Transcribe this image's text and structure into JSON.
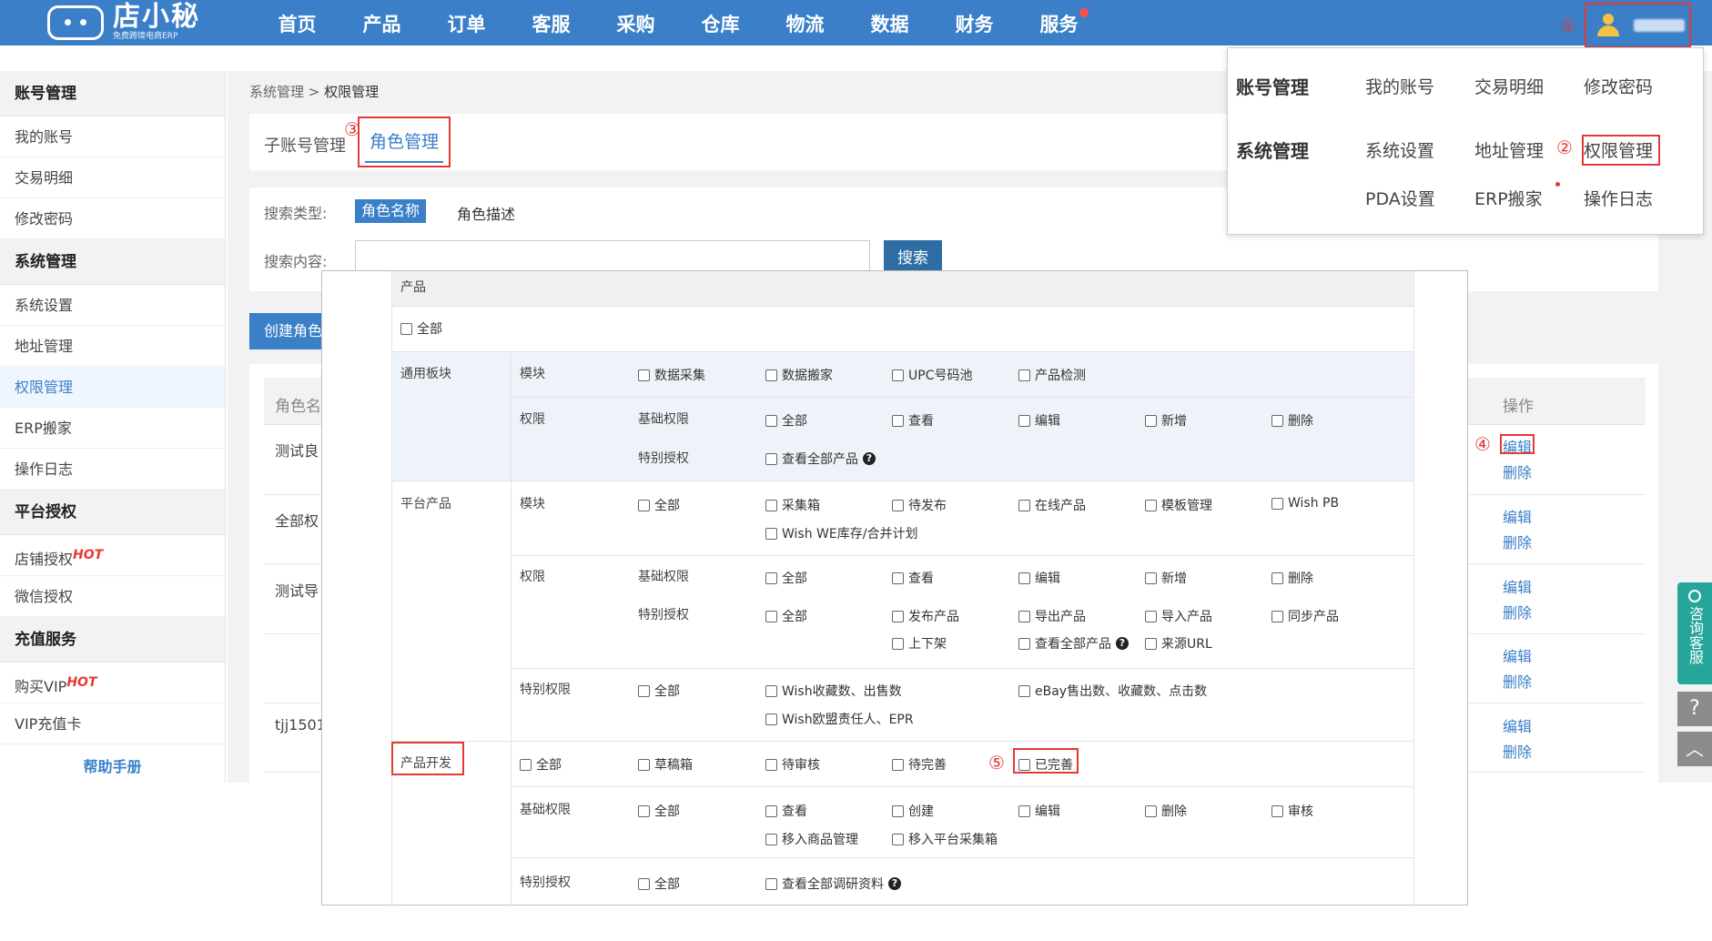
{
  "brand": {
    "name": "店小秘",
    "tagline": "免费跨境电商ERP"
  },
  "nav": {
    "items": [
      "首页",
      "产品",
      "订单",
      "客服",
      "采购",
      "仓库",
      "物流",
      "数据",
      "财务",
      "服务"
    ]
  },
  "markers": {
    "m1": "①",
    "m2": "②",
    "m3": "③",
    "m4": "④",
    "m5": "⑤"
  },
  "sidebar": {
    "groups": [
      {
        "title": "账号管理",
        "items": [
          "我的账号",
          "交易明细",
          "修改密码"
        ]
      },
      {
        "title": "系统管理",
        "items": [
          "系统设置",
          "地址管理",
          "权限管理",
          "ERP搬家",
          "操作日志"
        ]
      },
      {
        "title": "平台授权",
        "items": [
          "店铺授权",
          "微信授权"
        ]
      },
      {
        "title": "充值服务",
        "items": [
          "购买VIP",
          "VIP充值卡"
        ]
      }
    ],
    "hot": "HOT",
    "help": "帮助手册"
  },
  "breadcrumb": {
    "parent": "系统管理",
    "sep": ">",
    "current": "权限管理"
  },
  "tabs": {
    "sub_account": "子账号管理",
    "role": "角色管理"
  },
  "search": {
    "type_label": "搜索类型:",
    "type_active": "角色名称",
    "type_other": "角色描述",
    "content_label": "搜索内容:",
    "button": "搜索"
  },
  "create_button": "创建角色",
  "list": {
    "col_name": "角色名",
    "col_op": "操作",
    "rows": [
      "测试良",
      "全部权",
      "测试导",
      "",
      "tjj1501"
    ],
    "edit": "编辑",
    "delete": "删除"
  },
  "dropdown": {
    "account_head": "账号管理",
    "account_items": [
      "我的账号",
      "交易明细",
      "修改密码"
    ],
    "system_head": "系统管理",
    "system_items": [
      "系统设置",
      "地址管理",
      "权限管理"
    ],
    "system_items2": [
      "PDA设置",
      "ERP搬家",
      "操作日志"
    ]
  },
  "float": {
    "consult": "咨询客服",
    "help": "?",
    "top": "︿"
  },
  "modal": {
    "section": "产品",
    "all": "全部",
    "general": {
      "title": "通用板块",
      "module_label": "模块",
      "modules": [
        "数据采集",
        "数据搬家",
        "UPC号码池",
        "产品检测"
      ],
      "perm_label": "权限",
      "basic_label": "基础权限",
      "basic": [
        "全部",
        "查看",
        "编辑",
        "新增",
        "删除"
      ],
      "special_label": "特别授权",
      "special": [
        "查看全部产品"
      ]
    },
    "platform": {
      "title": "平台产品",
      "module_label": "模块",
      "modules": [
        "全部",
        "采集箱",
        "待发布",
        "在线产品",
        "模板管理",
        "Wish PB",
        "Wish WE库存/合并计划"
      ],
      "perm_label": "权限",
      "basic_label": "基础权限",
      "basic": [
        "全部",
        "查看",
        "编辑",
        "新增",
        "删除"
      ],
      "special_label": "特别授权",
      "special": [
        "全部",
        "发布产品",
        "导出产品",
        "导入产品",
        "同步产品",
        "上下架",
        "查看全部产品",
        "来源URL"
      ],
      "special_perm_label": "特别权限",
      "special_perm": [
        "全部",
        "Wish收藏数、出售数",
        "eBay售出数、收藏数、点击数",
        "Wish欧盟责任人、EPR"
      ]
    },
    "dev": {
      "title": "产品开发",
      "stages": [
        "全部",
        "草稿箱",
        "待审核",
        "待完善",
        "已完善"
      ],
      "basic_label": "基础权限",
      "basic": [
        "全部",
        "查看",
        "创建",
        "编辑",
        "删除",
        "审核",
        "移入商品管理",
        "移入平台采集箱"
      ],
      "special_label": "特别授权",
      "special": [
        "全部",
        "查看全部调研资料"
      ]
    }
  }
}
